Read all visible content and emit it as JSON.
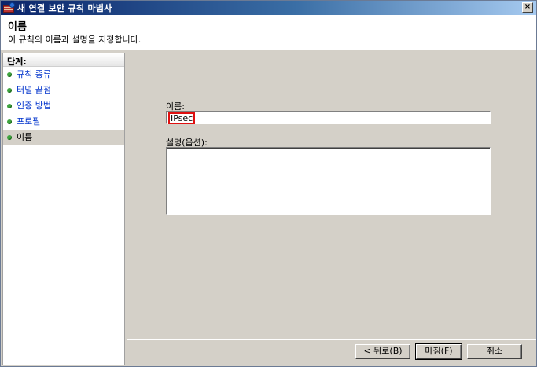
{
  "window": {
    "title": "새 연결 보안 규칙 마법사",
    "close_glyph": "×"
  },
  "header": {
    "title": "이름",
    "description": "이 규칙의 이름과 설명을 지정합니다."
  },
  "sidebar": {
    "heading": "단계:",
    "items": [
      {
        "label": "규칙 종류",
        "active": false
      },
      {
        "label": "터널 끝점",
        "active": false
      },
      {
        "label": "인증 방법",
        "active": false
      },
      {
        "label": "프로필",
        "active": false
      },
      {
        "label": "이름",
        "active": true
      }
    ]
  },
  "form": {
    "name_label": "이름:",
    "name_value": "IPsec",
    "description_label": "설명(옵션):",
    "description_value": ""
  },
  "buttons": {
    "back": "< 뒤로(B)",
    "finish": "마침(F)",
    "cancel": "취소"
  },
  "colors": {
    "titlebar_start": "#0a246a",
    "step_link": "#0033cc",
    "step_dot": "#3fa53f",
    "highlight": "#e01010"
  }
}
